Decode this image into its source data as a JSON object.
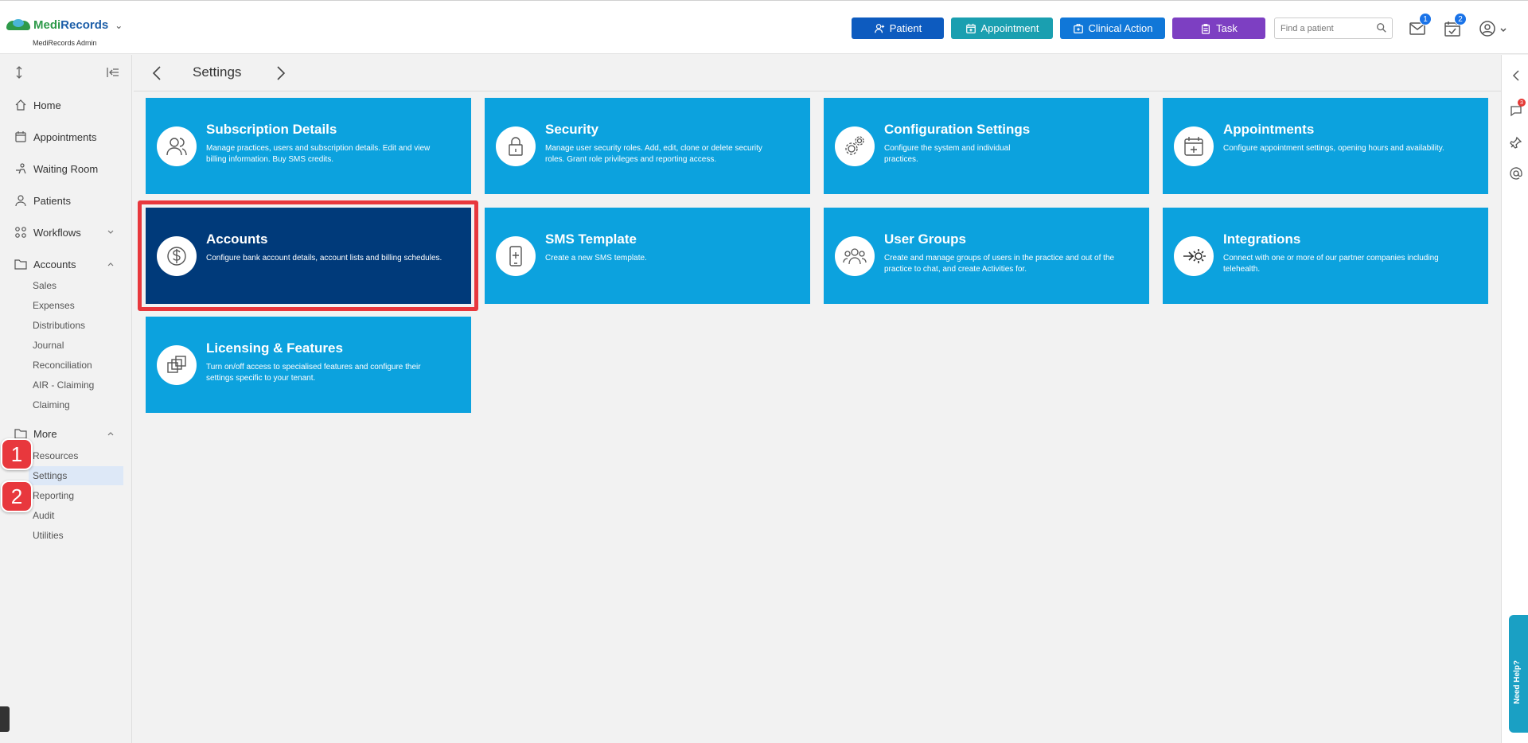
{
  "brand": {
    "name_part1": "Medi",
    "name_part2": "Records",
    "sub": "MediRecords Admin"
  },
  "header": {
    "buttons": {
      "patient": "Patient",
      "appointment": "Appointment",
      "clinical_action": "Clinical Action",
      "task": "Task"
    },
    "search_placeholder": "Find a patient",
    "mail_badge": "1",
    "tasks_badge": "2"
  },
  "sidebar": {
    "items": {
      "home": "Home",
      "appointments": "Appointments",
      "waiting_room": "Waiting Room",
      "patients": "Patients",
      "workflows": "Workflows",
      "accounts": "Accounts",
      "more": "More"
    },
    "accounts_sub": {
      "sales": "Sales",
      "expenses": "Expenses",
      "distributions": "Distributions",
      "journal": "Journal",
      "reconciliation": "Reconciliation",
      "air_claiming": "AIR - Claiming",
      "claiming": "Claiming"
    },
    "more_sub": {
      "resources": "Resources",
      "settings": "Settings",
      "reporting": "Reporting",
      "audit": "Audit",
      "utilities": "Utilities"
    },
    "steps": {
      "one": "1",
      "two": "2"
    }
  },
  "page": {
    "title": "Settings"
  },
  "tiles": {
    "subscription": {
      "title": "Subscription Details",
      "desc": "Manage practices, users and subscription details. Edit and view billing information. Buy SMS credits."
    },
    "security": {
      "title": "Security",
      "desc": "Manage user security roles. Add, edit, clone or delete security roles. Grant role privileges and reporting access."
    },
    "configuration": {
      "title": "Configuration Settings",
      "desc": "Configure the system and individual practices."
    },
    "appointments": {
      "title": "Appointments",
      "desc": "Configure appointment settings, opening hours and availability."
    },
    "accounts": {
      "title": "Accounts",
      "desc": "Configure bank account details, account lists and billing schedules."
    },
    "sms": {
      "title": "SMS Template",
      "desc": "Create a new SMS template."
    },
    "user_groups": {
      "title": "User Groups",
      "desc": "Create and manage groups of users in the practice and out of the practice to chat, and create Activities for."
    },
    "integrations": {
      "title": "Integrations",
      "desc": "Connect with one or more of our partner companies including telehealth."
    },
    "licensing": {
      "title": "Licensing & Features",
      "desc": "Turn on/off access to specialised features and configure their settings specific to your tenant."
    }
  },
  "rail": {
    "chat_badge": "3",
    "help_label": "Need Help?"
  },
  "colors": {
    "tile": "#0ca2de",
    "tile_selected": "#003a7a",
    "highlight": "#e8383d"
  }
}
